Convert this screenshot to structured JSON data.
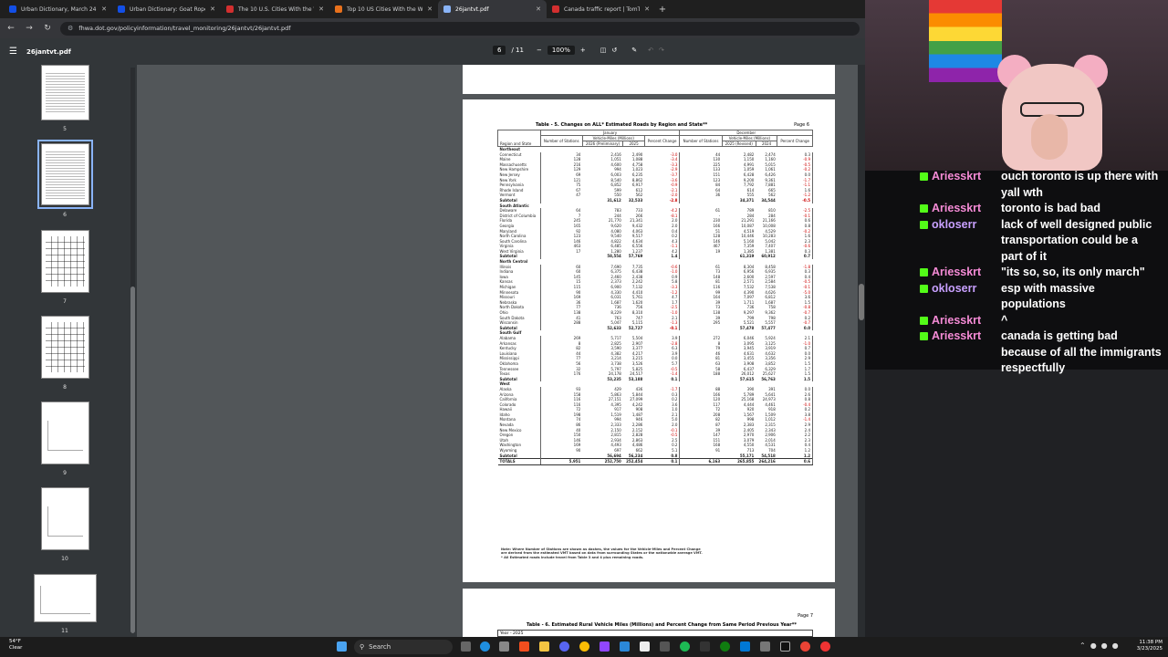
{
  "browser": {
    "tabs": [
      {
        "title": "Urban Dictionary, March 24: sc",
        "active": false
      },
      {
        "title": "Urban Dictionary: Goat Rope",
        "active": false
      },
      {
        "title": "The 10 U.S. Cities With the Wo",
        "active": false
      },
      {
        "title": "Top 10 US Cities With the Wor",
        "active": false
      },
      {
        "title": "26jantvt.pdf",
        "active": true
      },
      {
        "title": "Canada traffic report | TomTom",
        "active": false
      }
    ],
    "url": "fhwa.dot.gov/policyinformation/travel_monitoring/26jantvt/26jantvt.pdf"
  },
  "pdf": {
    "filename": "26jantvt.pdf",
    "page_current": "6",
    "page_total": "/ 11",
    "zoom": "100%",
    "thumb_numbers": [
      "5",
      "6",
      "7",
      "8",
      "9",
      "10",
      "11"
    ]
  },
  "table": {
    "title": "Table - 5.   Changes on ALL* Estimated Roads by Region and State**",
    "page": "Page 6",
    "hdr": {
      "january": "January",
      "december": "December",
      "vmt": "Vehicle-Miles (Millions)",
      "region_state": "Region and State",
      "stations": "Number of Stations",
      "y2026": "2026 (Preliminary)",
      "y2025": "2025",
      "pct": "Percent Change",
      "y2025r": "2025 (Revised)",
      "y2024": "2024"
    },
    "rows": [
      {
        "s": "Northeast",
        "r": true
      },
      {
        "s": "Connecticut",
        "v": [
          "34",
          "2,416",
          "2,490",
          "-3.0",
          "44",
          "2,482",
          "2,474",
          "0.3"
        ]
      },
      {
        "s": "Maine",
        "v": [
          "128",
          "1,051",
          "1,088",
          "-3.4",
          "130",
          "1,150",
          "1,160",
          "-0.9"
        ]
      },
      {
        "s": "Massachusetts",
        "v": [
          "216",
          "4,600",
          "4,758",
          "-3.3",
          "225",
          "4,991",
          "5,015",
          "-0.5"
        ]
      },
      {
        "s": "New Hampshire",
        "v": [
          "129",
          "994",
          "1,023",
          "-2.9",
          "133",
          "1,059",
          "1,061",
          "-0.2"
        ]
      },
      {
        "s": "New Jersey",
        "v": [
          "69",
          "6,003",
          "6,235",
          "-3.7",
          "151",
          "6,428",
          "6,426",
          "0.0"
        ]
      },
      {
        "s": "New York",
        "v": [
          "121",
          "8,540",
          "8,862",
          "-3.6",
          "123",
          "9,200",
          "9,361",
          "-1.7"
        ]
      },
      {
        "s": "Pennsylvania",
        "v": [
          "75",
          "6,852",
          "6,917",
          "-0.9",
          "84",
          "7,792",
          "7,881",
          "-1.1"
        ]
      },
      {
        "s": "Rhode Island",
        "v": [
          "67",
          "599",
          "612",
          "-2.1",
          "64",
          "614",
          "665",
          "1.6"
        ]
      },
      {
        "s": "Vermont",
        "v": [
          "47",
          "550",
          "562",
          "-2.0",
          "36",
          "555",
          "562",
          "-1.2"
        ]
      },
      {
        "s": "Subtotal",
        "v": [
          "",
          "31,612",
          "32,533",
          "-2.8",
          "",
          "34,371",
          "34,544",
          "-0.5"
        ],
        "sub": true
      },
      {
        "s": "South Atlantic",
        "r": true
      },
      {
        "s": "Delaware",
        "v": [
          "64",
          "783",
          "733",
          "-4.2",
          "61",
          "789",
          "810",
          "-2.5"
        ]
      },
      {
        "s": "District of Columbia",
        "v": [
          "7",
          "244",
          "266",
          "-8.1",
          "-",
          "284",
          "284",
          "-0.1"
        ]
      },
      {
        "s": "Florida",
        "v": [
          "245",
          "21,770",
          "21,341",
          "2.0",
          "230",
          "21,291",
          "21,166",
          "0.6"
        ]
      },
      {
        "s": "Georgia",
        "v": [
          "165",
          "9,620",
          "9,432",
          "2.0",
          "166",
          "10,087",
          "10,008",
          "0.8"
        ]
      },
      {
        "s": "Maryland",
        "v": [
          "92",
          "4,080",
          "4,063",
          "0.4",
          "51",
          "4,519",
          "4,529",
          "-0.2"
        ]
      },
      {
        "s": "North Carolina",
        "v": [
          "123",
          "9,540",
          "9,517",
          "0.2",
          "128",
          "10,446",
          "10,283",
          "1.6"
        ]
      },
      {
        "s": "South Carolina",
        "v": [
          "146",
          "4,822",
          "4,634",
          "4.3",
          "146",
          "5,160",
          "5,042",
          "2.3"
        ]
      },
      {
        "s": "Virginia",
        "v": [
          "463",
          "6,485",
          "6,556",
          "-1.1",
          "467",
          "7,359",
          "7,407",
          "-0.6"
        ]
      },
      {
        "s": "West Virginia",
        "v": [
          "17",
          "1,280",
          "1,237",
          "4.2",
          "19",
          "1,385",
          "1,381",
          "0.3"
        ]
      },
      {
        "s": "Subtotal",
        "v": [
          "",
          "58,554",
          "57,769",
          "1.4",
          "",
          "61,319",
          "60,912",
          "0.7"
        ],
        "sub": true
      },
      {
        "s": "North Central",
        "r": true
      },
      {
        "s": "Illinois",
        "v": [
          "60",
          "7,690",
          "7,735",
          "-0.6",
          "61",
          "8,304",
          "8,458",
          "-1.8"
        ]
      },
      {
        "s": "Indiana",
        "v": [
          "60",
          "6,375",
          "6,438",
          "-1.0",
          "73",
          "6,956",
          "6,935",
          "0.3"
        ]
      },
      {
        "s": "Iowa",
        "v": [
          "145",
          "2,460",
          "2,438",
          "0.9",
          "148",
          "2,600",
          "2,597",
          "0.4"
        ]
      },
      {
        "s": "Kansas",
        "v": [
          "15",
          "2,373",
          "2,242",
          "5.8",
          "81",
          "2,571",
          "2,584",
          "-0.5"
        ]
      },
      {
        "s": "Michigan",
        "v": [
          "115",
          "6,900",
          "7,132",
          "-3.3",
          "116",
          "7,532",
          "7,538",
          "-0.1"
        ]
      },
      {
        "s": "Minnesota",
        "v": [
          "90",
          "4,330",
          "4,410",
          "-1.2",
          "99",
          "4,390",
          "4,626",
          "-5.0"
        ]
      },
      {
        "s": "Missouri",
        "v": [
          "169",
          "6,031",
          "5,761",
          "4.7",
          "164",
          "7,097",
          "6,812",
          "3.6"
        ]
      },
      {
        "s": "Nebraska",
        "v": [
          "36",
          "1,687",
          "1,620",
          "1.7",
          "39",
          "1,711",
          "1,687",
          "1.5"
        ]
      },
      {
        "s": "North Dakota",
        "v": [
          "77",
          "736",
          "756",
          "-2.5",
          "73",
          "736",
          "758",
          "-0.8"
        ]
      },
      {
        "s": "Ohio",
        "v": [
          "138",
          "8,229",
          "8,310",
          "-1.0",
          "138",
          "9,297",
          "9,362",
          "-0.7"
        ]
      },
      {
        "s": "South Dakota",
        "v": [
          "41",
          "763",
          "747",
          "2.1",
          "39",
          "799",
          "798",
          "0.2"
        ]
      },
      {
        "s": "Wisconsin",
        "v": [
          "288",
          "5,047",
          "5,115",
          "-1.3",
          "295",
          "5,521",
          "5,557",
          "-0.7"
        ]
      },
      {
        "s": "Subtotal",
        "v": [
          "",
          "52,633",
          "52,727",
          "-0.1",
          "",
          "57,478",
          "57,477",
          "0.0"
        ],
        "sub": true
      },
      {
        "s": "South Gulf",
        "r": true
      },
      {
        "s": "Alabama",
        "v": [
          "269",
          "5,717",
          "5,504",
          "3.9",
          "272",
          "6,046",
          "5,924",
          "2.1"
        ]
      },
      {
        "s": "Arkansas",
        "v": [
          "8",
          "2,825",
          "2,907",
          "-2.8",
          "8",
          "3,095",
          "3,125",
          "-1.0"
        ]
      },
      {
        "s": "Kentucky",
        "v": [
          "82",
          "3,590",
          "3,377",
          "6.3",
          "79",
          "3,945",
          "3,919",
          "0.7"
        ]
      },
      {
        "s": "Louisiana",
        "v": [
          "44",
          "4,382",
          "4,217",
          "3.9",
          "46",
          "4,631",
          "4,632",
          "0.0"
        ]
      },
      {
        "s": "Mississippi",
        "v": [
          "77",
          "3,214",
          "3,215",
          "0.0",
          "81",
          "3,455",
          "3,356",
          "2.9"
        ]
      },
      {
        "s": "Oklahoma",
        "v": [
          "56",
          "3,738",
          "3,526",
          "5.7",
          "63",
          "3,908",
          "3,852",
          "1.5"
        ]
      },
      {
        "s": "Tennessee",
        "v": [
          "32",
          "5,797",
          "5,825",
          "-0.5",
          "58",
          "6,437",
          "6,329",
          "1.7"
        ]
      },
      {
        "s": "Texas",
        "v": [
          "176",
          "24,178",
          "24,517",
          "-1.4",
          "188",
          "26,012",
          "25,627",
          "1.5"
        ]
      },
      {
        "s": "Subtotal",
        "v": [
          "",
          "53,235",
          "53,188",
          "0.1",
          "",
          "57,615",
          "56,763",
          "1.5"
        ],
        "sub": true
      },
      {
        "s": "West",
        "r": true
      },
      {
        "s": "Alaska",
        "v": [
          "93",
          "429",
          "436",
          "-1.7",
          "88",
          "390",
          "391",
          "0.0"
        ]
      },
      {
        "s": "Arizona",
        "v": [
          "158",
          "5,863",
          "5,844",
          "0.3",
          "166",
          "5,789",
          "5,641",
          "2.6"
        ]
      },
      {
        "s": "California",
        "v": [
          "116",
          "27,151",
          "27,099",
          "0.2",
          "120",
          "25,168",
          "24,973",
          "0.8"
        ]
      },
      {
        "s": "Colorado",
        "v": [
          "116",
          "4,395",
          "4,242",
          "3.6",
          "117",
          "4,444",
          "4,461",
          "-0.4"
        ]
      },
      {
        "s": "Hawaii",
        "v": [
          "72",
          "917",
          "908",
          "1.0",
          "72",
          "920",
          "918",
          "0.2"
        ]
      },
      {
        "s": "Idaho",
        "v": [
          "198",
          "1,519",
          "1,487",
          "2.1",
          "208",
          "1,567",
          "1,509",
          "3.8"
        ]
      },
      {
        "s": "Montana",
        "v": [
          "74",
          "994",
          "946",
          "5.0",
          "82",
          "998",
          "1,012",
          "-1.4"
        ]
      },
      {
        "s": "Nevada",
        "v": [
          "86",
          "2,333",
          "2,286",
          "2.0",
          "87",
          "2,383",
          "2,315",
          "2.9"
        ]
      },
      {
        "s": "New Mexico",
        "v": [
          "40",
          "2,150",
          "2,152",
          "-0.1",
          "39",
          "2,405",
          "2,343",
          "2.4"
        ]
      },
      {
        "s": "Oregon",
        "v": [
          "150",
          "2,815",
          "2,828",
          "-0.5",
          "147",
          "2,970",
          "2,906",
          "2.2"
        ]
      },
      {
        "s": "Utah",
        "v": [
          "146",
          "2,934",
          "2,863",
          "2.5",
          "151",
          "3,079",
          "2,014",
          "2.3"
        ]
      },
      {
        "s": "Washington",
        "v": [
          "169",
          "4,493",
          "4,486",
          "0.2",
          "168",
          "4,550",
          "4,531",
          "0.4"
        ]
      },
      {
        "s": "Wyoming",
        "v": [
          "90",
          "697",
          "662",
          "5.1",
          "91",
          "713",
          "704",
          "1.2"
        ]
      },
      {
        "s": "Subtotal",
        "v": [
          "",
          "56,694",
          "56,234",
          "0.8",
          "",
          "55,171",
          "54,518",
          "1.2"
        ],
        "sub": true
      },
      {
        "s": "TOTALS",
        "v": [
          "5,951",
          "252,750",
          "252,454",
          "0.1",
          "6,163",
          "265,855",
          "264,216",
          "0.6"
        ],
        "tot": true
      }
    ],
    "notes": [
      "Note: Where Number of Stations are shown as dashes, the values for the Vehicle-Miles and Percent Change",
      "are derived from the estimated VMT based on data from surrounding States or the nationwide average VMT.",
      "* All Estimated roads include travel from Table 3 and 4 plus remaining roads."
    ]
  },
  "page7": {
    "title": "Table - 6.  Estimated Rural Vehicle Miles (Millions) and Percent Change from Same Period Previous Year**",
    "page": "Page 7",
    "year_label": "Year - 2025"
  },
  "chat": [
    {
      "user": "Ariesskrt",
      "text": "ouch toronto is up there with yall wth",
      "color": "#f58bd6"
    },
    {
      "user": "Ariesskrt",
      "text": "toronto is bad bad",
      "color": "#f58bd6"
    },
    {
      "user": "okloserr",
      "text": "lack of well designed public transportation could be a part of it",
      "color": "#c8a0ff"
    },
    {
      "user": "Ariesskrt",
      "text": "\"its so, so, its only march\"",
      "color": "#f58bd6"
    },
    {
      "user": "okloserr",
      "text": "esp with massive populations",
      "color": "#c8a0ff"
    },
    {
      "user": "Ariesskrt",
      "text": "^",
      "color": "#f58bd6"
    },
    {
      "user": "Ariesskrt",
      "text": "canada is getting bad because of all the immigrants respectfully",
      "color": "#f58bd6"
    }
  ],
  "taskbar": {
    "temp": "54°F",
    "weather": "Clear",
    "search": "Search",
    "time": "11:38 PM",
    "date": "3/23/2025"
  }
}
